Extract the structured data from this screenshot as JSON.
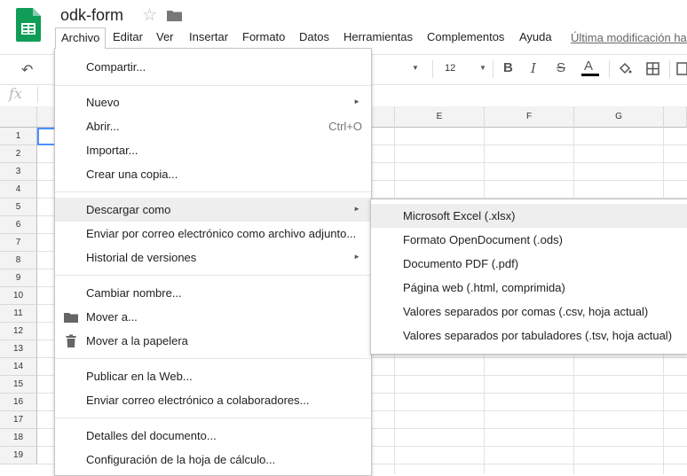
{
  "header": {
    "title": "odk-form",
    "last_modified": "Última modificación ha"
  },
  "menubar": [
    {
      "label": "Archivo",
      "name": "menu-archivo"
    },
    {
      "label": "Editar",
      "name": "menu-editar"
    },
    {
      "label": "Ver",
      "name": "menu-ver"
    },
    {
      "label": "Insertar",
      "name": "menu-insertar"
    },
    {
      "label": "Formato",
      "name": "menu-formato"
    },
    {
      "label": "Datos",
      "name": "menu-datos"
    },
    {
      "label": "Herramientas",
      "name": "menu-herramientas"
    },
    {
      "label": "Complementos",
      "name": "menu-complementos"
    },
    {
      "label": "Ayuda",
      "name": "menu-ayuda"
    }
  ],
  "toolbar": {
    "font_size": "12",
    "bold": "B",
    "italic": "I",
    "strike": "S",
    "text_color_glyph": "A"
  },
  "formula_bar": {
    "fx": "fx"
  },
  "grid": {
    "columns": [
      "E",
      "F",
      "G"
    ],
    "rows": [
      "1",
      "2",
      "3",
      "4",
      "5",
      "6",
      "7",
      "8",
      "9",
      "10",
      "11",
      "12",
      "13",
      "14",
      "15",
      "16",
      "17",
      "18",
      "19"
    ]
  },
  "file_menu": {
    "items": [
      {
        "label": "Compartir..."
      },
      {
        "label": "Nuevo",
        "submenu": true
      },
      {
        "label": "Abrir...",
        "shortcut": "Ctrl+O"
      },
      {
        "label": "Importar..."
      },
      {
        "label": "Crear una copia..."
      },
      {
        "label": "Descargar como",
        "submenu": true,
        "active": true
      },
      {
        "label": "Enviar por correo electrónico como archivo adjunto..."
      },
      {
        "label": "Historial de versiones",
        "submenu": true
      },
      {
        "label": "Cambiar nombre..."
      },
      {
        "label": "Mover a...",
        "icon": "folder-icon"
      },
      {
        "label": "Mover a la papelera",
        "icon": "trash-icon"
      },
      {
        "label": "Publicar en la Web..."
      },
      {
        "label": "Enviar correo electrónico a colaboradores..."
      },
      {
        "label": "Detalles del documento..."
      },
      {
        "label": "Configuración de la hoja de cálculo..."
      }
    ]
  },
  "download_submenu": {
    "items": [
      {
        "label": "Microsoft Excel (.xlsx)"
      },
      {
        "label": "Formato OpenDocument (.ods)"
      },
      {
        "label": "Documento PDF (.pdf)"
      },
      {
        "label": "Página web (.html, comprimida)"
      },
      {
        "label": "Valores separados por comas (.csv, hoja actual)"
      },
      {
        "label": "Valores separados por tabuladores (.tsv, hoja actual)"
      }
    ]
  },
  "colors": {
    "sheets_green": "#0f9d58",
    "selection_blue": "#4d90fe",
    "menu_hover": "#eeeeee"
  }
}
